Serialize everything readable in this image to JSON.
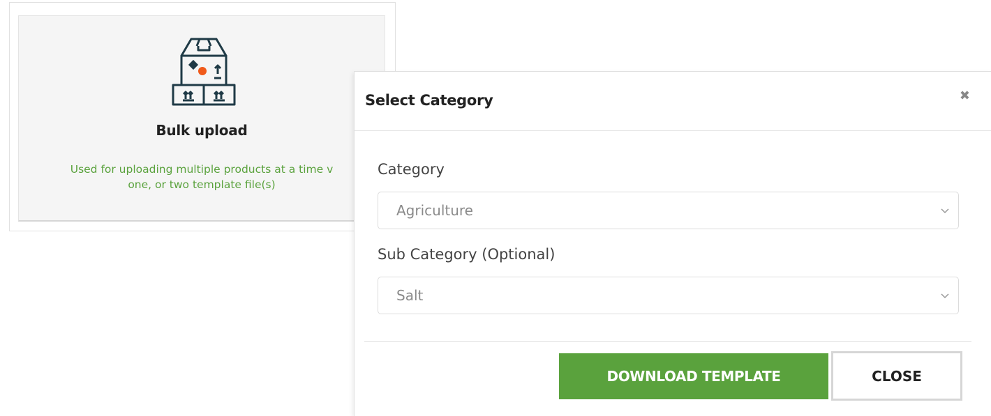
{
  "card": {
    "icon": "box-upload-icon",
    "title": "Bulk upload",
    "description_line1": "Used for uploading multiple products at a time v",
    "description_line2": "one, or two template file(s)",
    "accent_color": "#5aa23d",
    "icon_dot_color": "#f05a1a"
  },
  "modal": {
    "title": "Select Category",
    "close_icon": "close-icon",
    "category_label": "Category",
    "category_value": "Agriculture",
    "subcategory_label": "Sub Category (Optional)",
    "subcategory_value": "Salt",
    "download_label": "DOWNLOAD TEMPLATE",
    "close_label": "CLOSE",
    "primary_color": "#5aa23d"
  }
}
